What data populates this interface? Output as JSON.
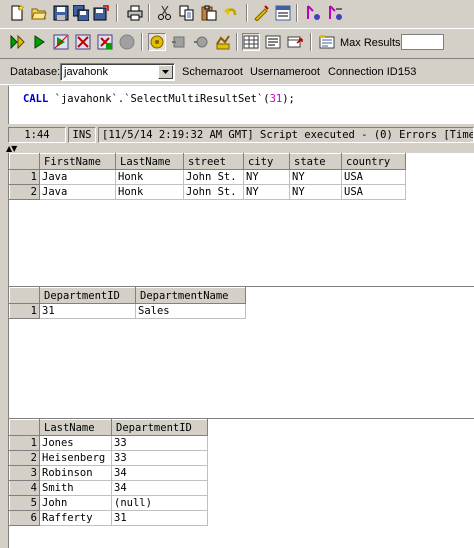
{
  "toolbar1": {
    "icons": [
      "new-icon",
      "open-icon",
      "save-icon",
      "save-all-icon",
      "export-icon",
      "print-icon",
      "cut-icon",
      "copy-icon",
      "paste-icon",
      "undo-icon",
      "format-icon",
      "indent-icon",
      "find-icon",
      "replace-icon"
    ]
  },
  "toolbar2": {
    "icons": [
      "execute-icon",
      "run-icon",
      "explain-icon",
      "stop-icon",
      "step-icon",
      "cancel-icon",
      "autocommit-icon",
      "commit-icon",
      "rollback-icon",
      "transaction-icon",
      "grid-icon",
      "text-icon",
      "export-results-icon",
      "options-icon"
    ],
    "max_results_label": "Max Results:",
    "max_results_value": ""
  },
  "dbbar": {
    "database_label": "Database:",
    "database_value": "javahonk",
    "schema_label": "Schema:",
    "schema_value": "root",
    "username_label": "Username:",
    "username_value": "root",
    "connection_label": "Connection ID:",
    "connection_value": "153"
  },
  "editor": {
    "keyword": "CALL",
    "body": " `javahonk`.`SelectMultiResultSet`(",
    "arg": "31",
    "tail": ");"
  },
  "status": {
    "position": "1:44",
    "mode": "INS",
    "message": "[11/5/14 2:19:32 AM GMT] Script executed - (0) Errors [Time"
  },
  "results": [
    {
      "columns": [
        "FirstName",
        "LastName",
        "street",
        "city",
        "state",
        "country"
      ],
      "rows": [
        [
          "1",
          "Java",
          "Honk",
          "John St.",
          "NY",
          "NY",
          "USA"
        ],
        [
          "2",
          "Java",
          "Honk",
          "John St.",
          "NY",
          "NY",
          "USA"
        ]
      ]
    },
    {
      "columns": [
        "DepartmentID",
        "DepartmentName"
      ],
      "rows": [
        [
          "1",
          "31",
          "Sales"
        ]
      ]
    },
    {
      "columns": [
        "LastName",
        "DepartmentID"
      ],
      "rows": [
        [
          "1",
          "Jones",
          "33"
        ],
        [
          "2",
          "Heisenberg",
          "33"
        ],
        [
          "3",
          "Robinson",
          "34"
        ],
        [
          "4",
          "Smith",
          "34"
        ],
        [
          "5",
          "John",
          "(null)"
        ],
        [
          "6",
          "Rafferty",
          "31"
        ]
      ]
    }
  ]
}
